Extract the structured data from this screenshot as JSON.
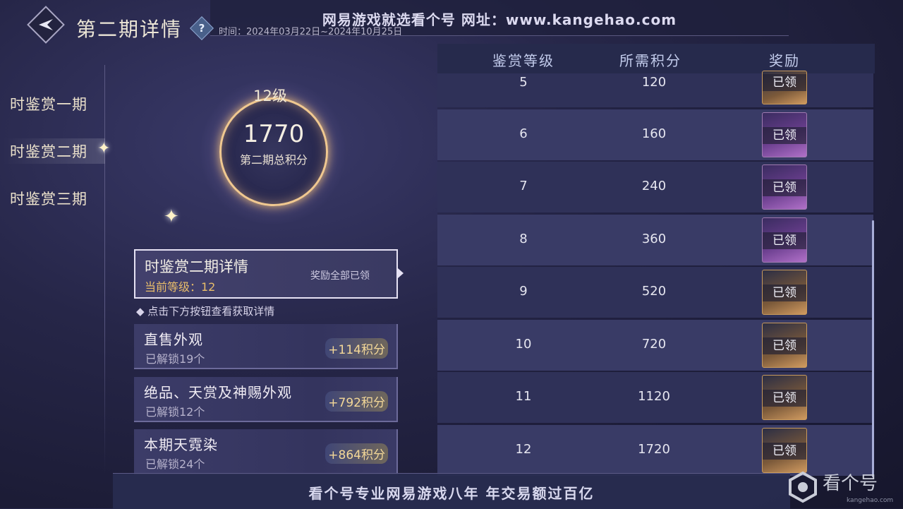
{
  "header": {
    "title": "第二期详情",
    "time_label": "时间：2024年03月22日~2024年10月25日",
    "banner_top": "网易游戏就选看个号   网址：www.kangehao.com"
  },
  "nav": {
    "items": [
      {
        "label": "时鉴赏一期"
      },
      {
        "label": "时鉴赏二期"
      },
      {
        "label": "时鉴赏三期"
      }
    ],
    "active_index": 1
  },
  "score": {
    "level": "12级",
    "total": "1770",
    "caption": "第二期总积分"
  },
  "detail": {
    "title": "时鉴赏二期详情",
    "current_level": "当前等级：12",
    "status": "奖励全部已领",
    "hint": "◆ 点击下方按钮查看获取详情"
  },
  "categories": [
    {
      "title": "直售外观",
      "unlocked": "已解锁19个",
      "points": "+114积分"
    },
    {
      "title": "绝品、天赏及神赐外观",
      "unlocked": "已解锁12个",
      "points": "+792积分"
    },
    {
      "title": "本期天霓染",
      "unlocked": "已解锁24个",
      "points": "+864积分"
    }
  ],
  "table": {
    "headers": {
      "level": "鉴赏等级",
      "points": "所需积分",
      "reward": "奖励"
    },
    "rows": [
      {
        "level": "5",
        "points": "120",
        "reward": "已领",
        "style": "orange"
      },
      {
        "level": "6",
        "points": "160",
        "reward": "已领",
        "style": "purple"
      },
      {
        "level": "7",
        "points": "240",
        "reward": "已领",
        "style": "purple"
      },
      {
        "level": "8",
        "points": "360",
        "reward": "已领",
        "style": "purple"
      },
      {
        "level": "9",
        "points": "520",
        "reward": "已领",
        "style": "orange"
      },
      {
        "level": "10",
        "points": "720",
        "reward": "已领",
        "style": "orange"
      },
      {
        "level": "11",
        "points": "1120",
        "reward": "已领",
        "style": "orange"
      },
      {
        "level": "12",
        "points": "1720",
        "reward": "已领",
        "style": "orange"
      }
    ]
  },
  "footer": {
    "banner_bottom": "看个号专业网易游戏八年   年交易额过百亿",
    "watermark_brand": "看个号",
    "watermark_domain": "kangehao.com"
  },
  "colors": {
    "accent_gold": "#e9bd6a",
    "points_gold": "#f4d898",
    "ring_gold": "#f0c890",
    "header_text": "#c3ccec"
  },
  "icons": [
    "back-icon",
    "help-icon",
    "sparkle-icon",
    "diamond-bullet-icon",
    "reward-item-icon",
    "watermark-logo-icon"
  ]
}
